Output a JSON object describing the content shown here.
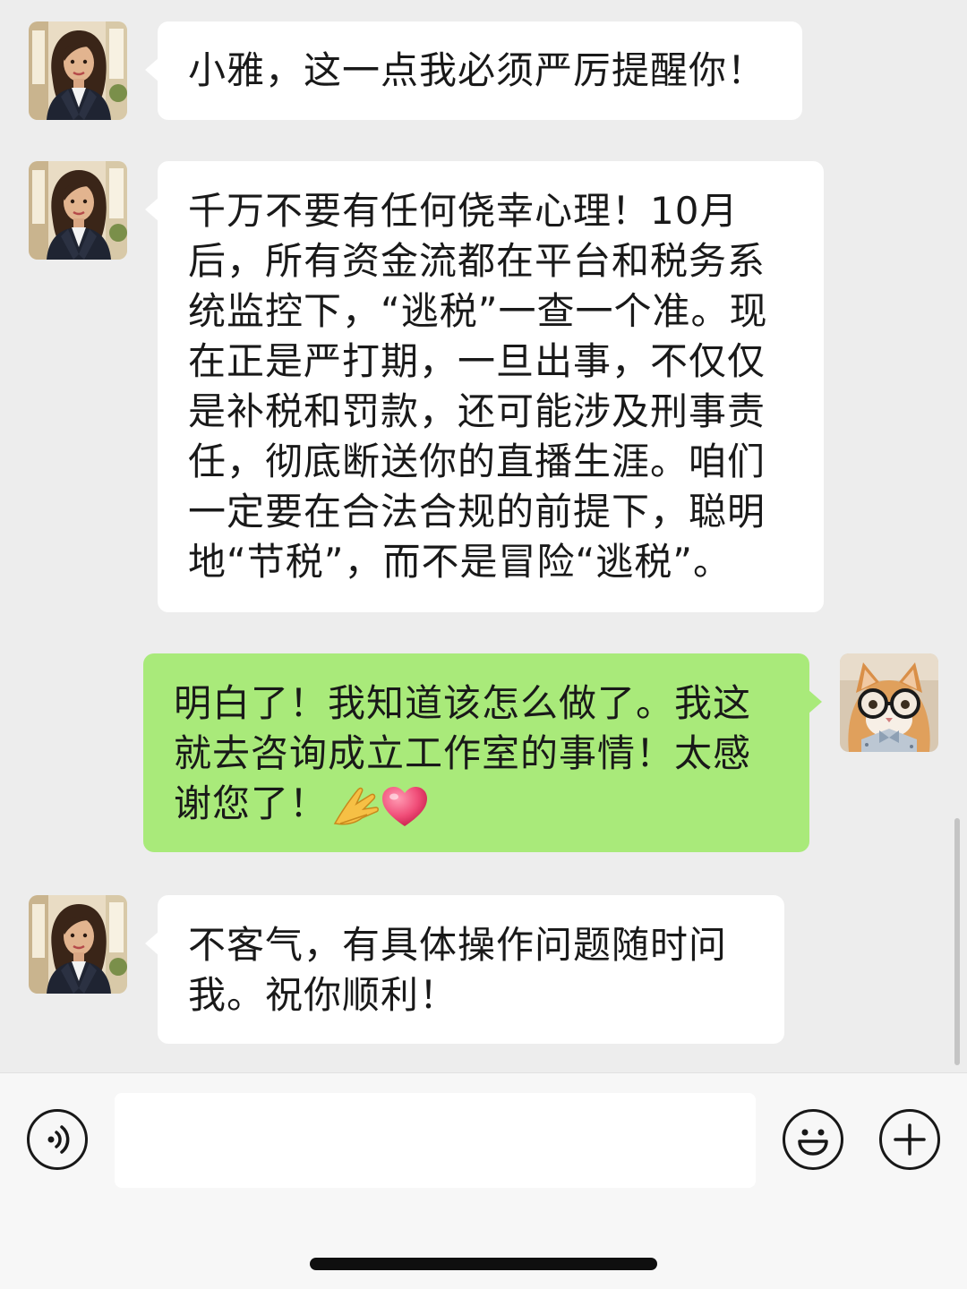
{
  "messages": [
    {
      "side": "incoming",
      "sender_avatar": "woman-in-suit-avatar",
      "lines": [
        "小雅，这一点我必须严厉提醒你！"
      ]
    },
    {
      "side": "incoming",
      "sender_avatar": "woman-in-suit-avatar",
      "lines": [
        "千万不要有任何侥幸心理！10月",
        "后，所有资金流都在平台和税务系",
        "统监控下，“逃税”一查一个准。现",
        "在正是严打期，一旦出事，不仅仅",
        "是补税和罚款，还可能涉及刑事责",
        "任，彻底断送你的直播生涯。咱们",
        "一定要在合法合规的前提下，聪明",
        "地“节税”，而不是冒险“逃税”。"
      ]
    },
    {
      "side": "outgoing",
      "sender_avatar": "cat-with-glasses-avatar",
      "lines": [
        "明白了！我知道该怎么做了。我这",
        "就去咨询成立工作室的事情！太感",
        "谢您了！"
      ],
      "trailing_emojis": [
        "folded-hands-emoji",
        "heart-emoji"
      ]
    },
    {
      "side": "incoming",
      "sender_avatar": "woman-in-suit-avatar",
      "lines": [
        "不客气，有具体操作问题随时问",
        "我。祝你顺利！"
      ]
    }
  ],
  "input_bar": {
    "voice_icon": "voice-icon",
    "text_value": "",
    "emoji_icon": "emoji-icon",
    "plus_icon": "plus-icon"
  },
  "colors": {
    "chat_background": "#ededed",
    "incoming_bubble": "#ffffff",
    "outgoing_bubble": "#a9ea7a",
    "input_bar_background": "#f7f7f7"
  }
}
